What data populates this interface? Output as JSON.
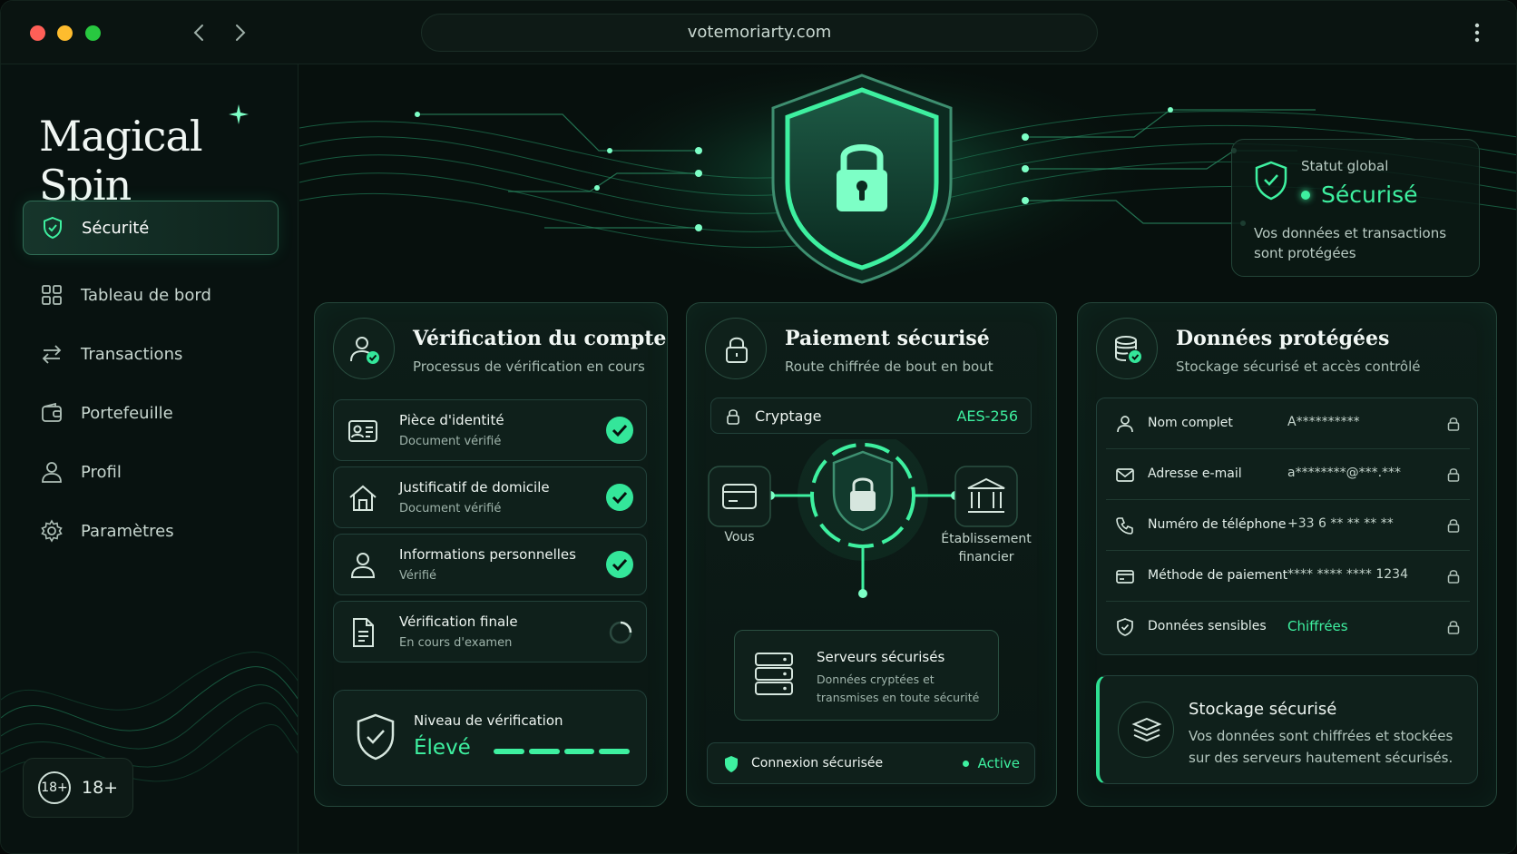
{
  "browser": {
    "url": "votemoriarty.com"
  },
  "sidebar": {
    "logo": "Magical Spin",
    "items": [
      {
        "label": "Sécurité",
        "icon": "shield-icon",
        "active": true
      },
      {
        "label": "Tableau de bord",
        "icon": "grid-icon",
        "active": false
      },
      {
        "label": "Transactions",
        "icon": "arrows-icon",
        "active": false
      },
      {
        "label": "Portefeuille",
        "icon": "wallet-icon",
        "active": false
      },
      {
        "label": "Profil",
        "icon": "user-icon",
        "active": false
      },
      {
        "label": "Paramètres",
        "icon": "gear-icon",
        "active": false
      }
    ],
    "age_badge": {
      "circle": "18+",
      "label": "18+"
    }
  },
  "status": {
    "label": "Statut global",
    "value": "Sécurisé",
    "description": "Vos données et transactions sont protégées"
  },
  "verification": {
    "title": "Vérification du compte",
    "subtitle": "Processus de vérification en cours",
    "rows": [
      {
        "title": "Pièce d'identité",
        "status": "Document vérifié",
        "state": "done",
        "icon": "id-card-icon"
      },
      {
        "title": "Justificatif de domicile",
        "status": "Document vérifié",
        "state": "done",
        "icon": "home-icon"
      },
      {
        "title": "Informations personnelles",
        "status": "Vérifié",
        "state": "done",
        "icon": "user-icon"
      },
      {
        "title": "Vérification finale",
        "status": "En cours d'examen",
        "state": "pending",
        "icon": "document-icon"
      }
    ],
    "level": {
      "label": "Niveau de vérification",
      "value": "Élevé",
      "filled_segments": 4,
      "total_segments": 4
    }
  },
  "payment": {
    "title": "Paiement sécurisé",
    "subtitle": "Route chiffrée de bout en bout",
    "encryption": {
      "label": "Cryptage",
      "value": "AES-256"
    },
    "flow": {
      "left_label": "Vous",
      "right_label_line1": "Établissement",
      "right_label_line2": "financier"
    },
    "servers": {
      "title": "Serveurs sécurisés",
      "description": "Données cryptées et transmises en toute sécurité"
    },
    "connection": {
      "label": "Connexion sécurisée",
      "value": "Active"
    }
  },
  "data_protection": {
    "title": "Données protégées",
    "subtitle": "Stockage sécurisé et accès contrôlé",
    "rows": [
      {
        "label": "Nom complet",
        "value": "A**********",
        "icon": "user-icon"
      },
      {
        "label": "Adresse e-mail",
        "value": "a********@***.***",
        "icon": "mail-icon"
      },
      {
        "label": "Numéro de téléphone",
        "value": "+33 6 ** ** ** **",
        "icon": "phone-icon"
      },
      {
        "label": "Méthode de paiement",
        "value": "**** **** **** 1234",
        "icon": "card-icon"
      },
      {
        "label": "Données sensibles",
        "value": "Chiffrées",
        "icon": "shield-icon"
      }
    ],
    "storage": {
      "title": "Stockage sécurisé",
      "description": "Vos données sont chiffrées et stockées sur des serveurs hautement sécurisés."
    }
  },
  "colors": {
    "accent": "#3ef0a0",
    "background": "#07100d",
    "card": "#0d1d18"
  }
}
